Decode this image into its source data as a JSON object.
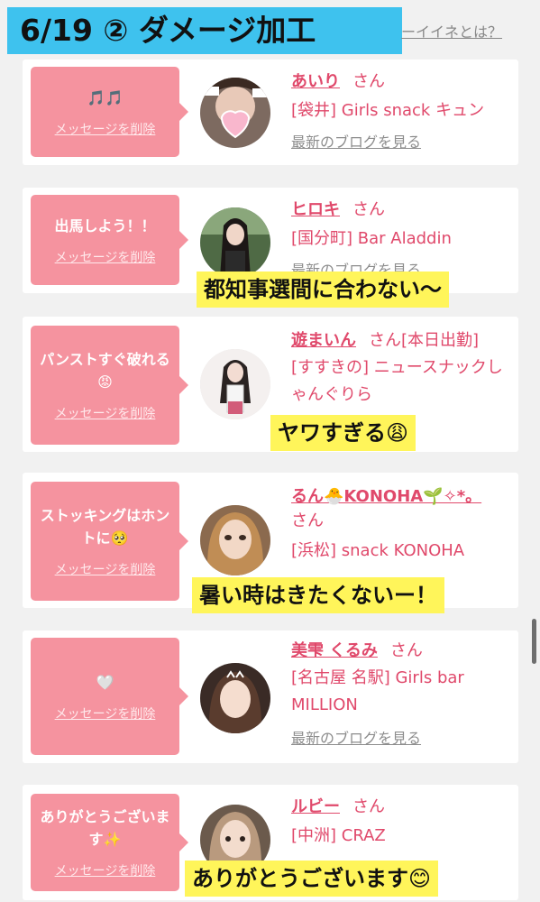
{
  "header": {
    "banner_title": "6/19 ② ダメージ加工",
    "top_link": "ーイイネとは？"
  },
  "delete_label": "メッセージを削除",
  "blog_label": "最新のブログを見る",
  "san_label": "さん",
  "cards": [
    {
      "message": "🎵🎵",
      "name": "あいり",
      "san_suffix": "さん",
      "shop": "[袋井] Girls snack キュン",
      "blog": "最新のブログを見る",
      "caption": ""
    },
    {
      "message": "出馬しよう！！",
      "name": "ヒロキ",
      "san_suffix": "さん",
      "shop": "[国分町] Bar Aladdin",
      "blog": "最新のブログを見る",
      "caption": "都知事選間に合わない〜"
    },
    {
      "message": "パンストすぐ破れる😡",
      "name": "遊まいん",
      "san_suffix": "さん[本日出勤]",
      "shop": "[すすきの] ニュースナックしゃんぐりら",
      "blog": "",
      "caption": "ヤワすぎる😩"
    },
    {
      "message": "ストッキングはホントに🥺",
      "name": "るん🐣KONOHA🌱✧*。",
      "san_suffix": "さん",
      "shop": "[浜松] snack KONOHA",
      "blog": "",
      "caption": "暑い時はきたくないー！"
    },
    {
      "message": "🤍",
      "name": "美雫 くるみ",
      "san_suffix": "さん",
      "shop": "[名古屋 名駅] Girls bar MILLION",
      "blog": "最新のブログを見る",
      "caption": ""
    },
    {
      "message": "ありがとうございます✨",
      "name": "ルビー",
      "san_suffix": "さん",
      "shop": "[中洲] CRAZ",
      "blog": "",
      "caption": "ありがとうございます😊"
    }
  ]
}
